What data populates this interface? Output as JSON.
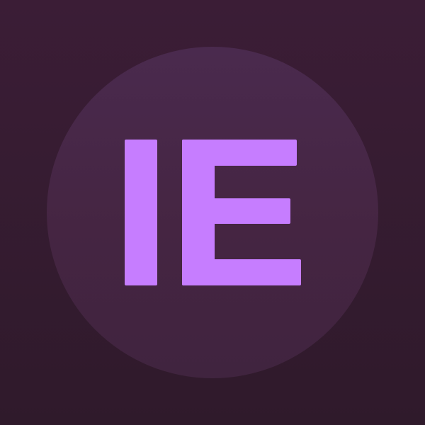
{
  "avatar": {
    "initials": "IE",
    "colors": {
      "background": "#351c32",
      "circle": "#4a2a4e",
      "text": "#c67dff"
    }
  }
}
